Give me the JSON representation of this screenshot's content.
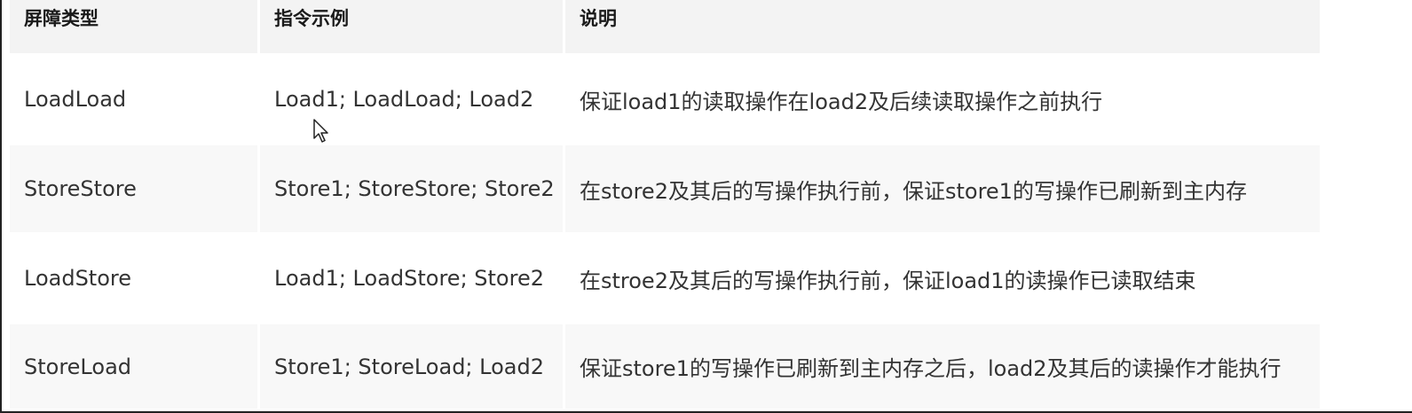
{
  "table": {
    "headers": [
      "屏障类型",
      "指令示例",
      "说明"
    ],
    "rows": [
      [
        "LoadLoad",
        "Load1; LoadLoad; Load2",
        "保证load1的读取操作在load2及后续读取操作之前执行"
      ],
      [
        "StoreStore",
        "Store1; StoreStore; Store2",
        "在store2及其后的写操作执行前，保证store1的写操作已刷新到主内存"
      ],
      [
        "LoadStore",
        "Load1; LoadStore; Store2",
        "在stroe2及其后的写操作执行前，保证load1的读操作已读取结束"
      ],
      [
        "StoreLoad",
        "Store1; StoreLoad; Load2",
        "保证store1的写操作已刷新到主内存之后，load2及其后的读操作才能执行"
      ]
    ]
  },
  "cursor": {
    "icon": "mouse-pointer-icon"
  }
}
